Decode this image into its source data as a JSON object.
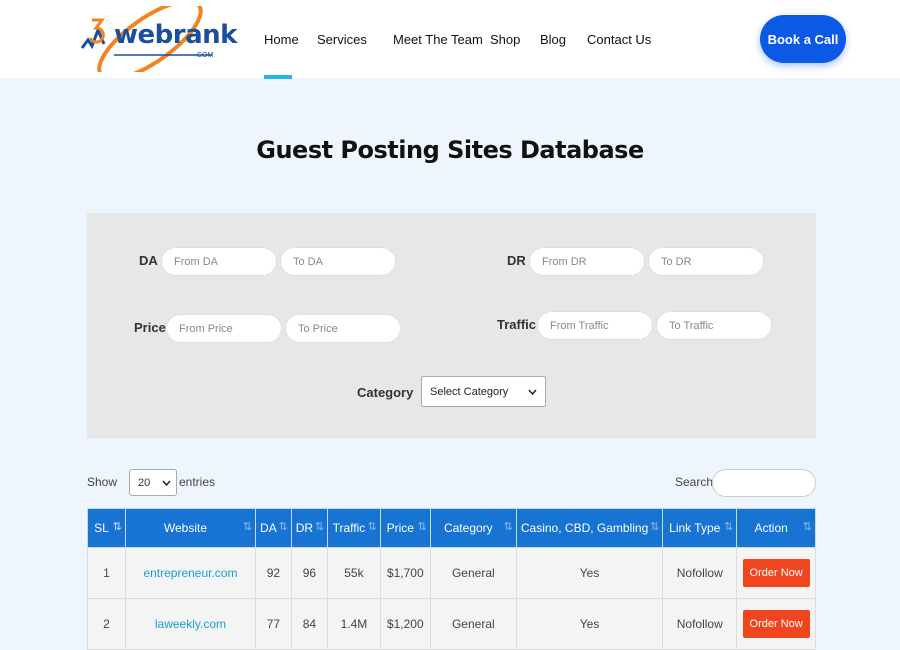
{
  "header": {
    "logo": {
      "brand": "webrank",
      "sub": ".COM"
    },
    "nav": [
      "Home",
      "Services",
      "Meet The Team",
      "Shop",
      "Blog",
      "Contact Us"
    ],
    "cta": "Book a Call"
  },
  "page": {
    "title": "Guest Posting Sites Database"
  },
  "filters": {
    "da_label": "DA",
    "da_from": "From DA",
    "da_to": "To DA",
    "dr_label": "DR",
    "dr_from": "From DR",
    "dr_to": "To DR",
    "price_label": "Price",
    "price_from": "From Price",
    "price_to": "To Price",
    "traffic_label": "Traffic",
    "traffic_from": "From Traffic",
    "traffic_to": "To Traffic",
    "category_label": "Category",
    "category_value": "Select Category"
  },
  "controls": {
    "show": "Show",
    "entries_value": "20",
    "entries": "entries",
    "search": "Search:"
  },
  "table": {
    "headers": [
      "SL",
      "Website",
      "DA",
      "DR",
      "Traffic",
      "Price",
      "Category",
      "Casino, CBD, Gambling",
      "Link Type",
      "Action"
    ],
    "rows": [
      [
        "1",
        "entrepreneur.com",
        "92",
        "96",
        "55k",
        "$1,700",
        "General",
        "Yes",
        "Nofollow",
        "Order Now"
      ],
      [
        "2",
        "laweekly.com",
        "77",
        "84",
        "1.4M",
        "$1,200",
        "General",
        "Yes",
        "Nofollow",
        "Order Now"
      ]
    ]
  },
  "colors": {
    "accent": "#1774d3",
    "button": "#0c59e5",
    "order": "#f0461f",
    "link": "#1a9ed8"
  }
}
